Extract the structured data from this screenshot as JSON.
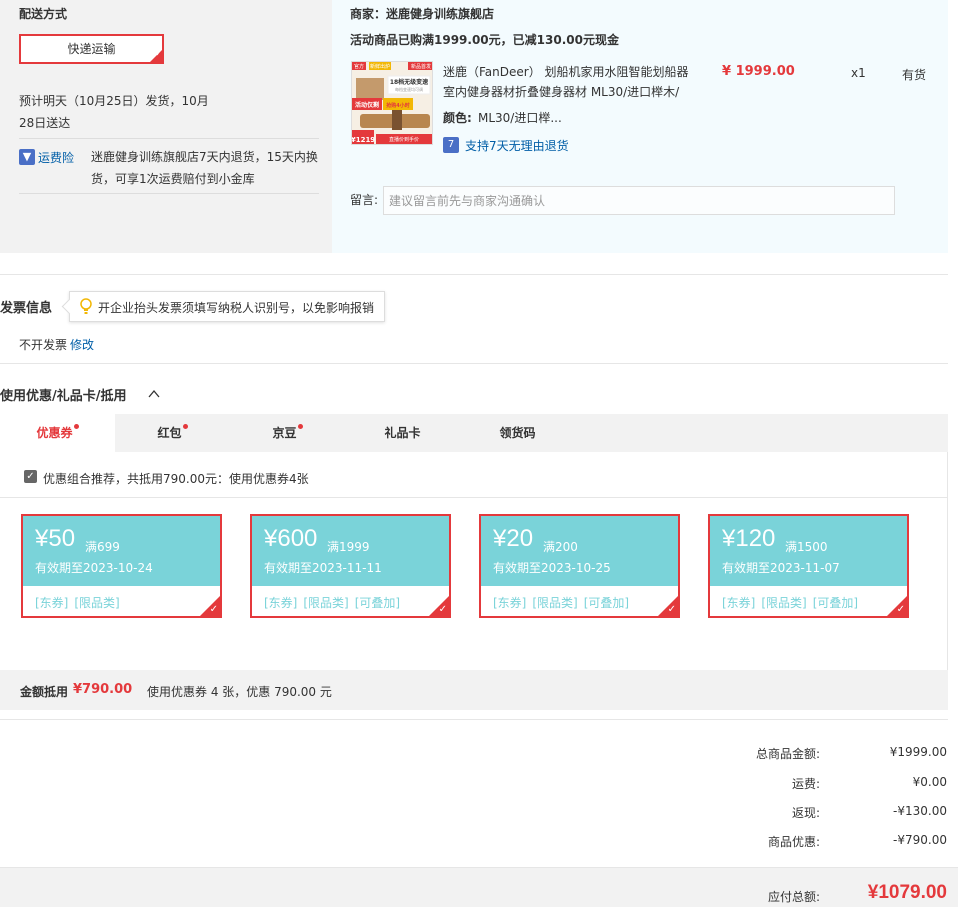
{
  "shipping": {
    "title": "配送方式",
    "option": "快递运输",
    "estimate": "预计明天（10月25日）发货，10月28日送达",
    "insurance_icon": "shield-icon",
    "insurance_label": "运费险",
    "insurance_desc": "迷鹿健身训练旗舰店7天内退货，15天内换货，可享1次运费赔付到小金库"
  },
  "shop": {
    "name": "商家：迷鹿健身训练旗舰店",
    "promo": "活动商品已购满1999.00元，已减130.00元现金"
  },
  "product": {
    "name": "迷鹿（FanDeer） 划船机家用水阻智能划船器室内健身器材折叠健身器材 ML30/进口榉木/",
    "color_label": "颜色:",
    "color_value": "ML30/进口榉...",
    "return_icon": "seven-day-return-icon",
    "return_text": "支持7天无理由退货",
    "price": "¥ 1999.00",
    "qty": "x1",
    "stock": "有货",
    "image_texts": {
      "badge1": "官方",
      "badge2": "新鲜出炉",
      "badge3": "新品首发",
      "headline": "18档无级变速",
      "sub": "每档变速均可调",
      "promo": "活动仅剩",
      "promo2": "抢购4小时",
      "price": "¥1219",
      "tag": "直播价到手价"
    }
  },
  "message": {
    "label": "留言:",
    "placeholder": "建议留言前先与商家沟通确认"
  },
  "invoice": {
    "title": "发票信息",
    "tip_icon": "lightbulb-icon",
    "tip": "开企业抬头发票须填写纳税人识别号，以免影响报销",
    "status": "不开发票",
    "edit": "修改"
  },
  "coupons": {
    "title": "使用优惠/礼品卡/抵用",
    "toggle_icon": "chevron-up-icon",
    "tabs": [
      {
        "label": "优惠券",
        "dot": true
      },
      {
        "label": "红包",
        "dot": true
      },
      {
        "label": "京豆",
        "dot": true
      },
      {
        "label": "礼品卡",
        "dot": false
      },
      {
        "label": "领货码",
        "dot": false
      }
    ],
    "recommend": "优惠组合推荐，共抵用790.00元：使用优惠券4张",
    "items": [
      {
        "amount": "¥50",
        "cond": "满699",
        "expire": "有效期至2023-10-24",
        "tags": [
          "[东券]",
          "[限品类]"
        ]
      },
      {
        "amount": "¥600",
        "cond": "满1999",
        "expire": "有效期至2023-11-11",
        "tags": [
          "[东券]",
          "[限品类]",
          "[可叠加]"
        ]
      },
      {
        "amount": "¥20",
        "cond": "满200",
        "expire": "有效期至2023-10-25",
        "tags": [
          "[东券]",
          "[限品类]",
          "[可叠加]"
        ]
      },
      {
        "amount": "¥120",
        "cond": "满1500",
        "expire": "有效期至2023-11-07",
        "tags": [
          "[东券]",
          "[限品类]",
          "[可叠加]"
        ]
      }
    ],
    "summary_label": "金额抵用",
    "summary_amount": "¥790.00",
    "summary_desc": "使用优惠券 4 张，优惠 790.00 元"
  },
  "totals": {
    "goods_label": "总商品金额:",
    "goods_value": "¥1999.00",
    "freight_label": "运费:",
    "freight_value": "¥0.00",
    "cashback_label": "返现:",
    "cashback_value": "-¥130.00",
    "discount_label": "商品优惠:",
    "discount_value": "-¥790.00",
    "grand_label": "应付总额:",
    "grand_value": "¥1079.00"
  },
  "colors": {
    "accent": "#e4393c",
    "link": "#005ea7",
    "coupon": "#7ad3d9"
  }
}
